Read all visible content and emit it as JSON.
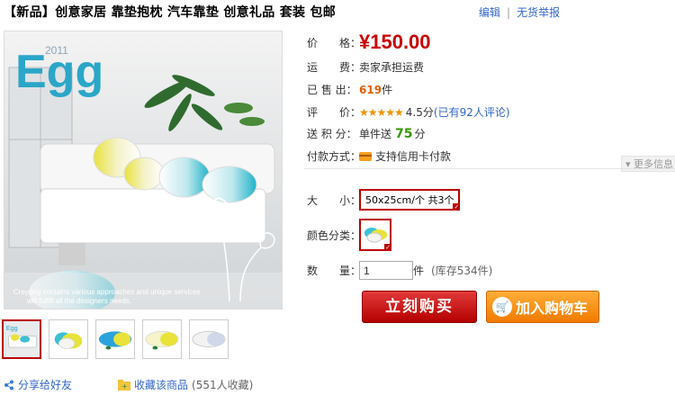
{
  "header": {
    "title": "【新品】创意家居 靠垫抱枕 汽车靠垫 创意礼品 套装 包邮",
    "edit_link": "编辑",
    "report_link": "无货举报",
    "separator": "|"
  },
  "gallery": {
    "main_image_year": "2011",
    "main_image_brand": "Egg",
    "main_image_caption_line1": "Creyong contains various approaches and unique services",
    "main_image_caption_line2": "will fulfill all the designers needs.",
    "thumbnail_count": 5,
    "selected_thumbnail": 1
  },
  "share": {
    "label": "分享给好友"
  },
  "favorite": {
    "label": "收藏该商品",
    "count": "(551人收藏)"
  },
  "props": {
    "price_label": "价　　格：",
    "price_value": "¥150.00",
    "shipping_label": "运　　费：",
    "shipping_value": "卖家承担运费",
    "sold_label": "已 售 出：",
    "sold_count": "619",
    "sold_unit": "件",
    "rating_label": "评　　价：",
    "rating_stars": "★★★★★",
    "rating_score": "4.5分",
    "rating_reviews": "(已有92人评论)",
    "points_label": "送 积 分：",
    "points_prefix": "单件送",
    "points_value": "75",
    "points_unit": "分",
    "payment_label": "付款方式：",
    "payment_value": "支持信用卡付款",
    "more_info": "更多信息"
  },
  "options": {
    "size_label": "大　　小：",
    "size_value": "50x25cm/个 共3个",
    "color_label": "颜色分类：",
    "quantity_label": "数　　量：",
    "quantity_value": "1",
    "quantity_unit": "件",
    "stock": "(库存534件)"
  },
  "actions": {
    "buy_now": "立刻购买",
    "add_to_cart": "加入购物车"
  },
  "colors": {
    "price": "#c80000",
    "buy_button": "#c80000",
    "cart_button": "#f17a00",
    "link": "#3366cc"
  }
}
